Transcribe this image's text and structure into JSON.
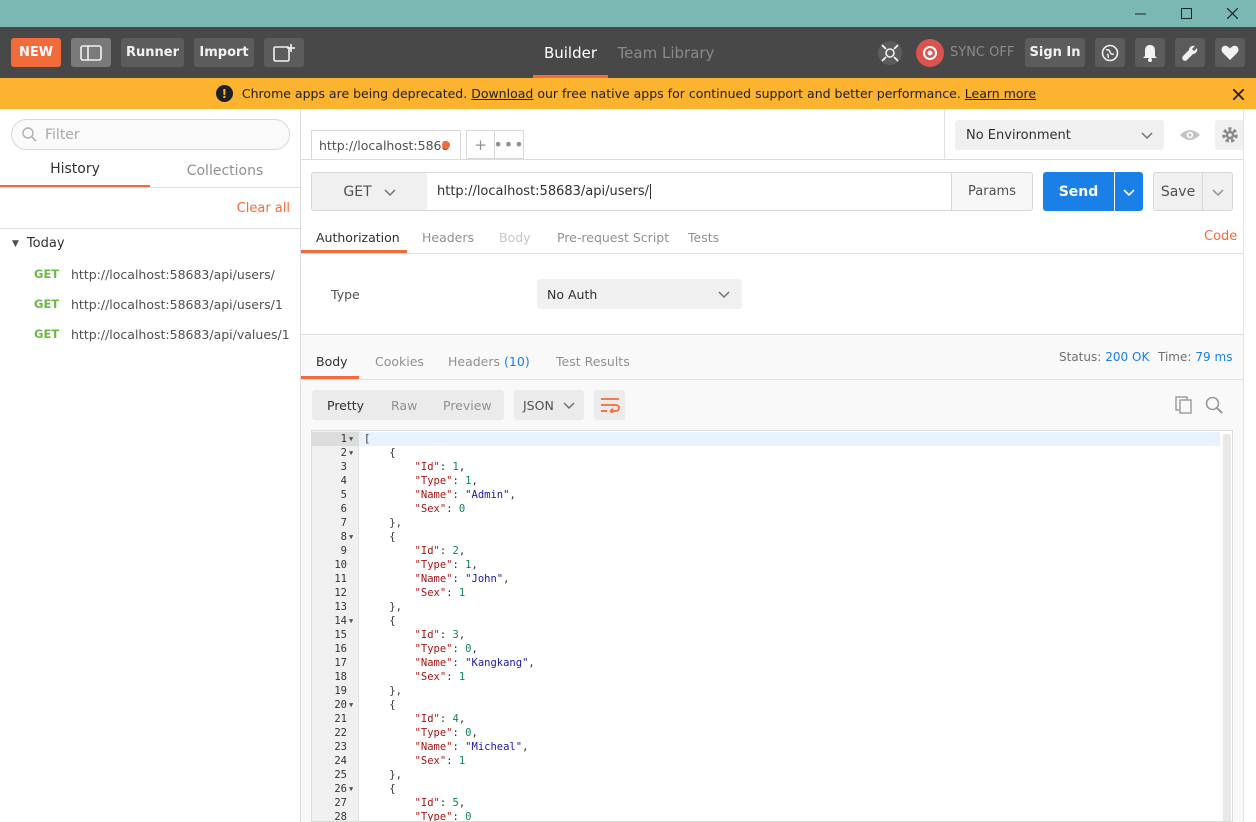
{
  "app": {
    "header_buttons": {
      "new": "NEW",
      "runner": "Runner",
      "import": "Import"
    },
    "tabs": {
      "builder": "Builder",
      "team_library": "Team Library"
    },
    "sync_label": "SYNC OFF",
    "sign_in": "Sign In"
  },
  "banner": {
    "text_before": "Chrome apps are being deprecated.",
    "download_link": "Download",
    "text_after": "our free native apps for continued support and better performance.",
    "learn_more": "Learn more"
  },
  "sidebar": {
    "filter_placeholder": "Filter",
    "tabs": {
      "history": "History",
      "collections": "Collections"
    },
    "clear_all": "Clear all",
    "group_label": "Today",
    "items": [
      {
        "method": "GET",
        "url": "http://localhost:58683/api/users/"
      },
      {
        "method": "GET",
        "url": "http://localhost:58683/api/users/1"
      },
      {
        "method": "GET",
        "url": "http://localhost:58683/api/values/1"
      }
    ]
  },
  "request_tab": {
    "label": "http://localhost:5868"
  },
  "environment": {
    "selected": "No Environment"
  },
  "request": {
    "method": "GET",
    "url": "http://localhost:58683/api/users/",
    "params_label": "Params",
    "send_label": "Send",
    "save_label": "Save"
  },
  "request_tabs": {
    "authorization": "Authorization",
    "headers": "Headers",
    "body": "Body",
    "pre_request": "Pre-request Script",
    "tests": "Tests",
    "code": "Code"
  },
  "auth": {
    "type_label": "Type",
    "selected": "No Auth"
  },
  "response": {
    "tabs": {
      "body": "Body",
      "cookies": "Cookies",
      "headers": "Headers",
      "headers_count": "(10)",
      "test_results": "Test Results"
    },
    "status_label": "Status:",
    "status_value": "200 OK",
    "time_label": "Time:",
    "time_value": "79 ms",
    "view_modes": {
      "pretty": "Pretty",
      "raw": "Raw",
      "preview": "Preview"
    },
    "format": "JSON"
  },
  "response_body": [
    {
      "id": 1,
      "type": 1,
      "name": "Admin",
      "sex": 0
    },
    {
      "id": 2,
      "type": 1,
      "name": "John",
      "sex": 1
    },
    {
      "id": 3,
      "type": 0,
      "name": "Kangkang",
      "sex": 1
    },
    {
      "id": 4,
      "type": 0,
      "name": "Micheal",
      "sex": 1
    },
    {
      "id": 5,
      "type": 0
    }
  ],
  "colors": {
    "accent": "#f26b3a",
    "header_bg": "#484848",
    "banner_bg": "#fcb330",
    "send_blue": "#1a7fe6",
    "get_green": "#6ab845"
  },
  "icons": {
    "sidebar_toggle": "sidebar-toggle-icon",
    "new_window": "new-window-icon",
    "interceptor": "interceptor-icon",
    "sync": "sync-icon",
    "globe": "globe-icon",
    "bell": "bell-icon",
    "wrench": "wrench-icon",
    "heart": "heart-icon",
    "warning": "warning-icon",
    "close": "close-icon",
    "search": "search-icon",
    "eye": "eye-icon",
    "gear": "gear-icon",
    "chevron": "chevron-down-icon",
    "wrap": "wrap-lines-icon",
    "copy": "copy-icon"
  }
}
